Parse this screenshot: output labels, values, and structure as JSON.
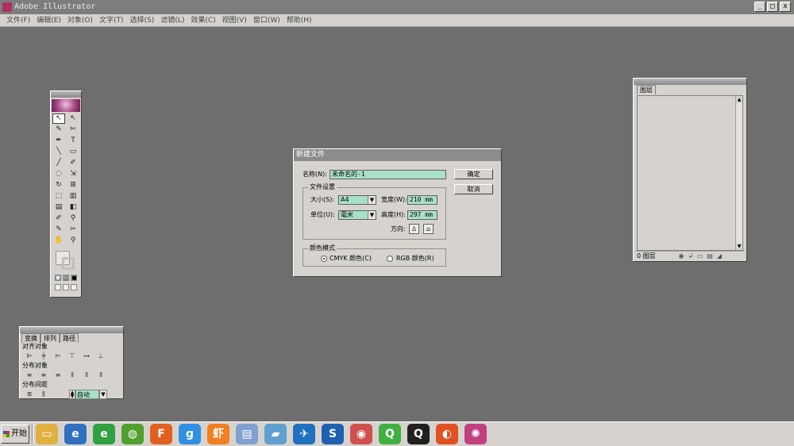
{
  "app": {
    "title": "Adobe Illustrator"
  },
  "window_buttons": [
    "_",
    "□",
    "x"
  ],
  "menu": [
    "文件(F)",
    "编辑(E)",
    "对象(O)",
    "文字(T)",
    "选择(S)",
    "滤镜(L)",
    "效果(C)",
    "视图(V)",
    "窗口(W)",
    "帮助(H)"
  ],
  "toolbox": {
    "tools": [
      "↖",
      "↖",
      "✎",
      "✄",
      "✒",
      "T",
      "╲",
      "▭",
      "╱",
      "✐",
      "◌",
      "⇲",
      "↻",
      "⊞",
      "⬚",
      "▥",
      "▤",
      "◧",
      "✐",
      "⚲",
      "✎",
      "✂",
      "✋",
      "⚲"
    ],
    "mini_buttons": [
      "□",
      "▥",
      "■"
    ]
  },
  "align_palette": {
    "tabs": [
      "变换",
      "排列",
      "路径"
    ],
    "section1": "对齐对象",
    "section2": "分布对象",
    "section3": "分布间距",
    "auto_value": "自动"
  },
  "layers_palette": {
    "tab": "图层",
    "footer_count": "0 图层"
  },
  "dialog": {
    "title": "新建文件",
    "name_label": "名称(N):",
    "name_value": "未命名的-1",
    "ok": "确定",
    "cancel": "取消",
    "doc_settings_legend": "文件设置",
    "size_label": "大小(S):",
    "size_value": "A4",
    "width_label": "宽度(W):",
    "width_value": "210 mm",
    "units_label": "单位(U):",
    "units_value": "毫米",
    "height_label": "高度(H):",
    "height_value": "297 mm",
    "orientation_label": "方向:",
    "color_mode_legend": "颜色模式",
    "cmyk_label": "CMYK 颜色(C)",
    "rgb_label": "RGB 颜色(R)"
  },
  "taskbar": {
    "start_label": "开始",
    "icons": [
      {
        "name": "desktop-icon",
        "glyph": "▭",
        "color": "#e0b040"
      },
      {
        "name": "ie-icon",
        "glyph": "e",
        "color": "#3070c0"
      },
      {
        "name": "ie-green-icon",
        "glyph": "e",
        "color": "#30a040"
      },
      {
        "name": "360-icon",
        "glyph": "◍",
        "color": "#50a030"
      },
      {
        "name": "foxmail-icon",
        "glyph": "F",
        "color": "#e06020"
      },
      {
        "name": "app-blue-icon",
        "glyph": "g",
        "color": "#3090e0"
      },
      {
        "name": "xiami-icon",
        "glyph": "虾",
        "color": "#f08020"
      },
      {
        "name": "doc-icon",
        "glyph": "▤",
        "color": "#80a0d0"
      },
      {
        "name": "book-icon",
        "glyph": "▰",
        "color": "#60a0d0"
      },
      {
        "name": "bird-icon",
        "glyph": "✈",
        "color": "#2070c0"
      },
      {
        "name": "sogou-icon",
        "glyph": "S",
        "color": "#2060b0"
      },
      {
        "name": "photo-icon",
        "glyph": "◉",
        "color": "#d05050"
      },
      {
        "name": "iqiyi-icon",
        "glyph": "Q",
        "color": "#40b040"
      },
      {
        "name": "qq-icon",
        "glyph": "Q",
        "color": "#202020"
      },
      {
        "name": "firefox-icon",
        "glyph": "◐",
        "color": "#e05020"
      },
      {
        "name": "illustrator-icon",
        "glyph": "✺",
        "color": "#c04080"
      }
    ]
  }
}
